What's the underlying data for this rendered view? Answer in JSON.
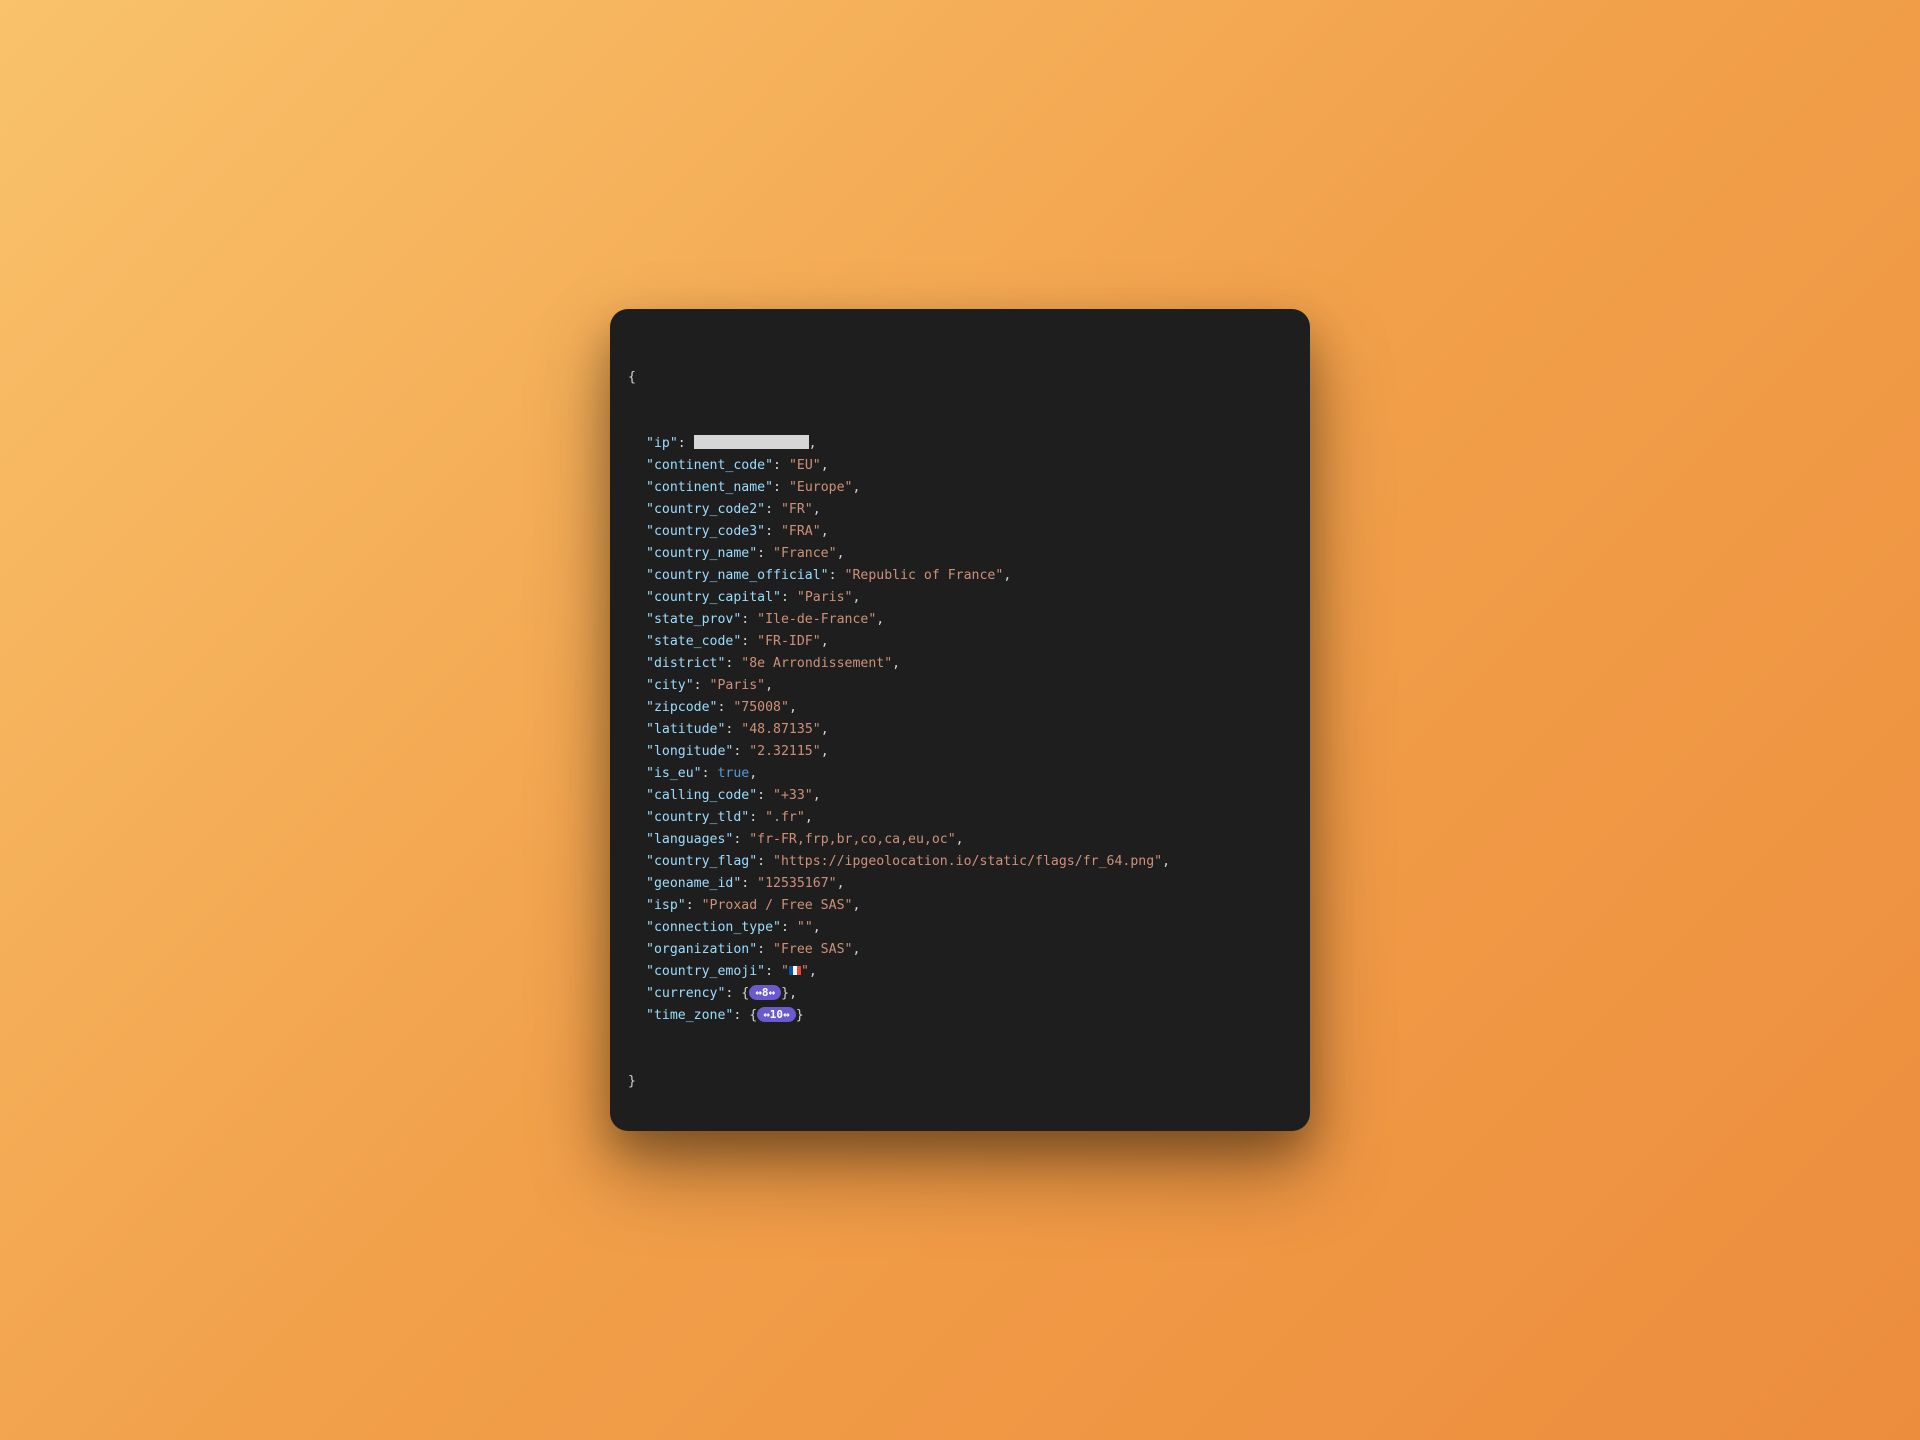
{
  "json": {
    "open_brace": "{",
    "close_brace": "}",
    "entries": [
      {
        "key": "\"ip\"",
        "type": "redacted"
      },
      {
        "key": "\"continent_code\"",
        "type": "string",
        "value": "\"EU\""
      },
      {
        "key": "\"continent_name\"",
        "type": "string",
        "value": "\"Europe\""
      },
      {
        "key": "\"country_code2\"",
        "type": "string",
        "value": "\"FR\""
      },
      {
        "key": "\"country_code3\"",
        "type": "string",
        "value": "\"FRA\""
      },
      {
        "key": "\"country_name\"",
        "type": "string",
        "value": "\"France\""
      },
      {
        "key": "\"country_name_official\"",
        "type": "string",
        "value": "\"Republic of France\""
      },
      {
        "key": "\"country_capital\"",
        "type": "string",
        "value": "\"Paris\""
      },
      {
        "key": "\"state_prov\"",
        "type": "string",
        "value": "\"Ile-de-France\""
      },
      {
        "key": "\"state_code\"",
        "type": "string",
        "value": "\"FR-IDF\""
      },
      {
        "key": "\"district\"",
        "type": "string",
        "value": "\"8e Arrondissement\""
      },
      {
        "key": "\"city\"",
        "type": "string",
        "value": "\"Paris\""
      },
      {
        "key": "\"zipcode\"",
        "type": "string",
        "value": "\"75008\""
      },
      {
        "key": "\"latitude\"",
        "type": "string",
        "value": "\"48.87135\""
      },
      {
        "key": "\"longitude\"",
        "type": "string",
        "value": "\"2.32115\""
      },
      {
        "key": "\"is_eu\"",
        "type": "bool",
        "value": "true"
      },
      {
        "key": "\"calling_code\"",
        "type": "string",
        "value": "\"+33\""
      },
      {
        "key": "\"country_tld\"",
        "type": "string",
        "value": "\".fr\""
      },
      {
        "key": "\"languages\"",
        "type": "string",
        "value": "\"fr-FR,frp,br,co,ca,eu,oc\""
      },
      {
        "key": "\"country_flag\"",
        "type": "string",
        "value": "\"https://ipgeolocation.io/static/flags/fr_64.png\""
      },
      {
        "key": "\"geoname_id\"",
        "type": "string",
        "value": "\"12535167\""
      },
      {
        "key": "\"isp\"",
        "type": "string",
        "value": "\"Proxad / Free SAS\""
      },
      {
        "key": "\"connection_type\"",
        "type": "string",
        "value": "\"\""
      },
      {
        "key": "\"organization\"",
        "type": "string",
        "value": "\"Free SAS\""
      },
      {
        "key": "\"country_emoji\"",
        "type": "flag"
      },
      {
        "key": "\"currency\"",
        "type": "badge",
        "badge": "↔8↔"
      },
      {
        "key": "\"time_zone\"",
        "type": "badge",
        "badge": "↔10↔",
        "last": true
      }
    ]
  }
}
